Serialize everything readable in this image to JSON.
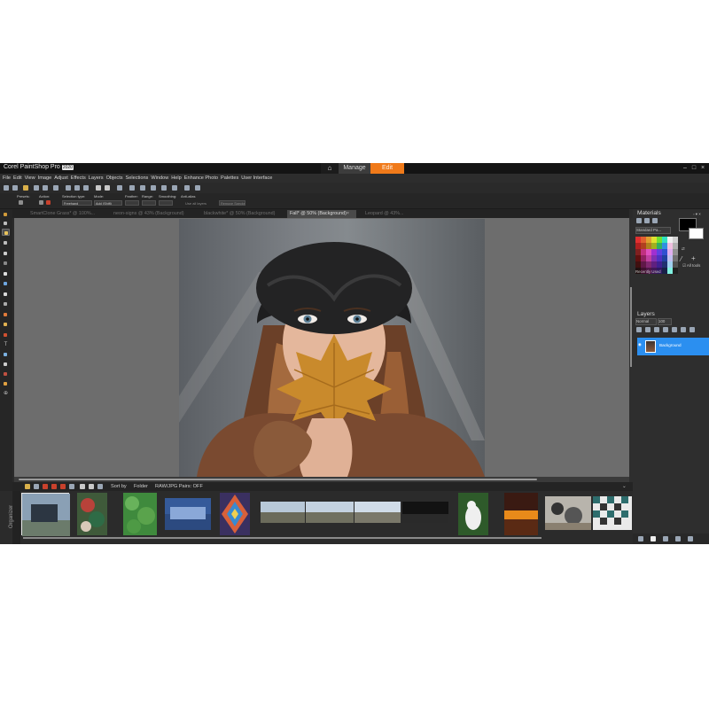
{
  "app": {
    "logo": "Corel PaintShop Pro",
    "version": "2020",
    "workspace_tabs": [
      "Manage",
      "Edit"
    ],
    "active_tab": "Edit",
    "accent_color": "#f07a1a"
  },
  "menu": [
    "File",
    "Edit",
    "View",
    "Image",
    "Adjust",
    "Effects",
    "Layers",
    "Objects",
    "Selections",
    "Window",
    "Help",
    "Enhance Photo",
    "Palettes",
    "User Interface"
  ],
  "tool_options": {
    "presets_label": "Presets:",
    "action_label": "Action:",
    "selection_type_label": "Selection type:",
    "selection_type_value": "Freehand",
    "mode_label": "Mode:",
    "mode_value": "Add (Shift)",
    "feather_label": "Feather:",
    "range_label": "Range:",
    "smoothing_label": "Smoothing:",
    "antialias_label": "Anti-alias",
    "use_all_layers_label": "Use all layers",
    "remove_specks_label": "Remove Specks"
  },
  "doc_tabs": [
    {
      "label": "SmartClone Grass* @ 100%..."
    },
    {
      "label": "neon-signs @ 43% (Background)"
    },
    {
      "label": "blackwhite* @ 50% (Background)"
    },
    {
      "label": "Fall* @ 50% (Background)",
      "active": true
    },
    {
      "label": "Leopard @ 43%..."
    }
  ],
  "organizer": {
    "title": "Organizer",
    "sort_by_label": "Sort by",
    "folder_label": "Folder",
    "raw_label": "RAW/JPG Pairs: OFF"
  },
  "materials": {
    "title": "Materials",
    "palette_select": "Standard Pa...",
    "all_tools_label": "All tools",
    "recently_used_label": "Recently Used",
    "foreground_color": "#000000",
    "background_color": "#ffffff"
  },
  "layers": {
    "title": "Layers",
    "blend_mode": "Normal",
    "opacity": "100",
    "items": [
      {
        "name": "Background",
        "selected": true
      }
    ]
  }
}
